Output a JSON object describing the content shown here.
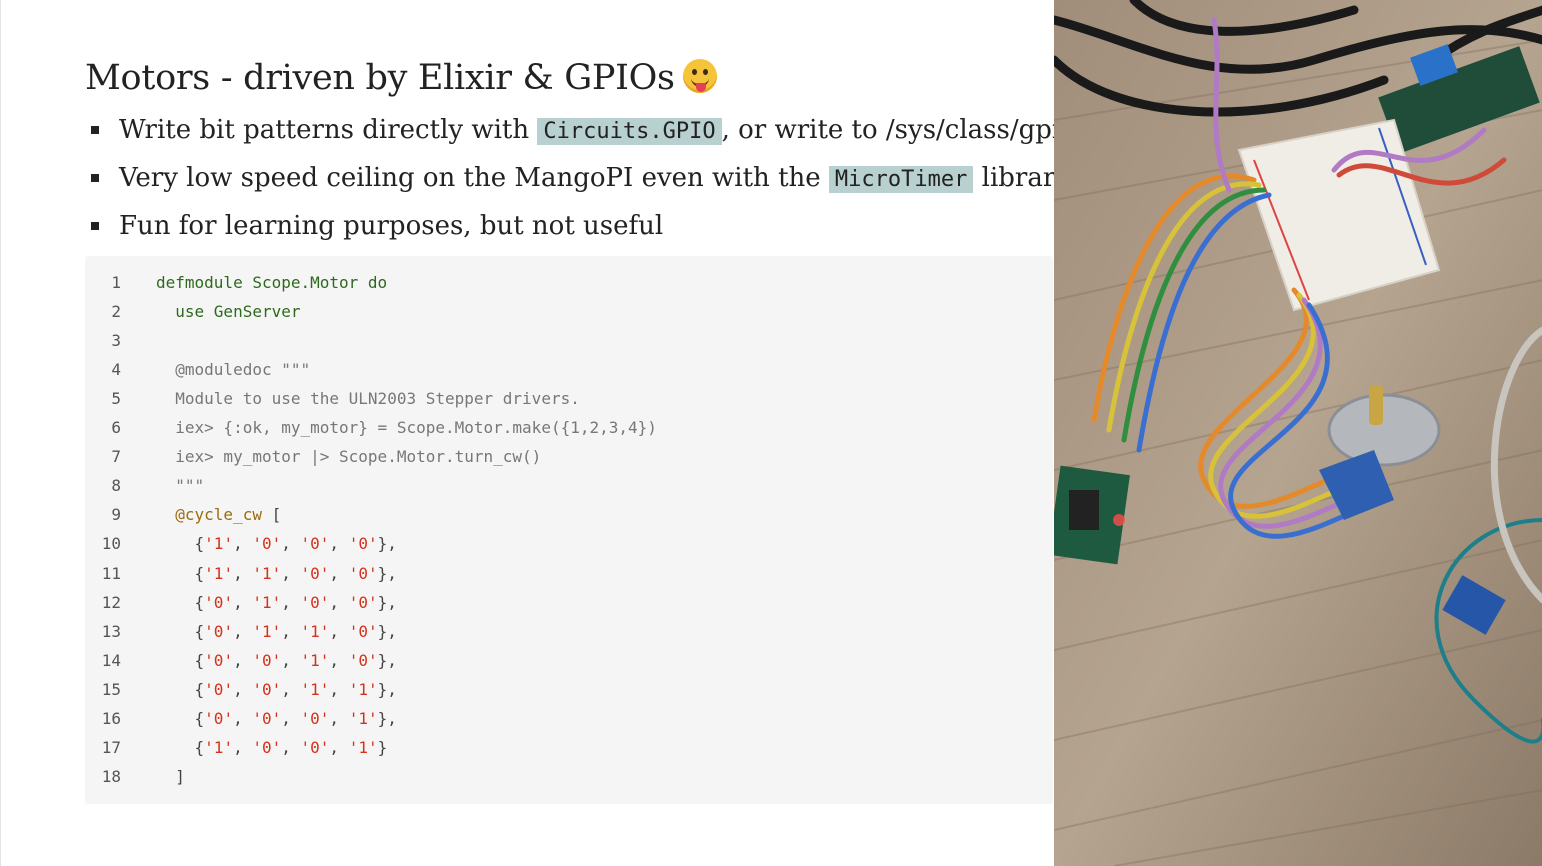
{
  "slide": {
    "title": "Motors - driven by Elixir & GPIOs",
    "title_emoji": "face-with-tongue-emoji",
    "bullets": [
      {
        "pre": "Write bit patterns directly with ",
        "code": "Circuits.GPIO",
        "post": ", or write to /sys/class/gpio/"
      },
      {
        "pre": "Very low speed ceiling on the MangoPI even with the ",
        "code": "MicroTimer",
        "post": " library"
      },
      {
        "pre": "Fun for learning purposes, but not useful",
        "code": "",
        "post": ""
      }
    ],
    "code_lines": [
      {
        "num": "1",
        "parts": [
          [
            "k",
            "defmodule Scope.Motor do"
          ]
        ]
      },
      {
        "num": "2",
        "parts": [
          [
            "p",
            "  "
          ],
          [
            "k",
            "use GenServer"
          ]
        ]
      },
      {
        "num": "3",
        "parts": []
      },
      {
        "num": "4",
        "parts": [
          [
            "c",
            "  @moduledoc \"\"\""
          ]
        ]
      },
      {
        "num": "5",
        "parts": [
          [
            "c",
            "  Module to use the ULN2003 Stepper drivers."
          ]
        ]
      },
      {
        "num": "6",
        "parts": [
          [
            "c",
            "  iex> {:ok, my_motor} = Scope.Motor.make({1,2,3,4})"
          ]
        ]
      },
      {
        "num": "7",
        "parts": [
          [
            "c",
            "  iex> my_motor |> Scope.Motor.turn_cw()"
          ]
        ]
      },
      {
        "num": "8",
        "parts": [
          [
            "c",
            "  \"\"\""
          ]
        ]
      },
      {
        "num": "9",
        "parts": [
          [
            "p",
            "  "
          ],
          [
            "a",
            "@cycle_cw"
          ],
          [
            "p",
            " ["
          ]
        ]
      },
      {
        "num": "10",
        "parts": [
          [
            "p",
            "    {"
          ],
          [
            "s",
            "'1'"
          ],
          [
            "p",
            ", "
          ],
          [
            "s",
            "'0'"
          ],
          [
            "p",
            ", "
          ],
          [
            "s",
            "'0'"
          ],
          [
            "p",
            ", "
          ],
          [
            "s",
            "'0'"
          ],
          [
            "p",
            "},"
          ]
        ]
      },
      {
        "num": "11",
        "parts": [
          [
            "p",
            "    {"
          ],
          [
            "s",
            "'1'"
          ],
          [
            "p",
            ", "
          ],
          [
            "s",
            "'1'"
          ],
          [
            "p",
            ", "
          ],
          [
            "s",
            "'0'"
          ],
          [
            "p",
            ", "
          ],
          [
            "s",
            "'0'"
          ],
          [
            "p",
            "},"
          ]
        ]
      },
      {
        "num": "12",
        "parts": [
          [
            "p",
            "    {"
          ],
          [
            "s",
            "'0'"
          ],
          [
            "p",
            ", "
          ],
          [
            "s",
            "'1'"
          ],
          [
            "p",
            ", "
          ],
          [
            "s",
            "'0'"
          ],
          [
            "p",
            ", "
          ],
          [
            "s",
            "'0'"
          ],
          [
            "p",
            "},"
          ]
        ]
      },
      {
        "num": "13",
        "parts": [
          [
            "p",
            "    {"
          ],
          [
            "s",
            "'0'"
          ],
          [
            "p",
            ", "
          ],
          [
            "s",
            "'1'"
          ],
          [
            "p",
            ", "
          ],
          [
            "s",
            "'1'"
          ],
          [
            "p",
            ", "
          ],
          [
            "s",
            "'0'"
          ],
          [
            "p",
            "},"
          ]
        ]
      },
      {
        "num": "14",
        "parts": [
          [
            "p",
            "    {"
          ],
          [
            "s",
            "'0'"
          ],
          [
            "p",
            ", "
          ],
          [
            "s",
            "'0'"
          ],
          [
            "p",
            ", "
          ],
          [
            "s",
            "'1'"
          ],
          [
            "p",
            ", "
          ],
          [
            "s",
            "'0'"
          ],
          [
            "p",
            "},"
          ]
        ]
      },
      {
        "num": "15",
        "parts": [
          [
            "p",
            "    {"
          ],
          [
            "s",
            "'0'"
          ],
          [
            "p",
            ", "
          ],
          [
            "s",
            "'0'"
          ],
          [
            "p",
            ", "
          ],
          [
            "s",
            "'1'"
          ],
          [
            "p",
            ", "
          ],
          [
            "s",
            "'1'"
          ],
          [
            "p",
            "},"
          ]
        ]
      },
      {
        "num": "16",
        "parts": [
          [
            "p",
            "    {"
          ],
          [
            "s",
            "'0'"
          ],
          [
            "p",
            ", "
          ],
          [
            "s",
            "'0'"
          ],
          [
            "p",
            ", "
          ],
          [
            "s",
            "'0'"
          ],
          [
            "p",
            ", "
          ],
          [
            "s",
            "'1'"
          ],
          [
            "p",
            "},"
          ]
        ]
      },
      {
        "num": "17",
        "parts": [
          [
            "p",
            "    {"
          ],
          [
            "s",
            "'1'"
          ],
          [
            "p",
            ", "
          ],
          [
            "s",
            "'0'"
          ],
          [
            "p",
            ", "
          ],
          [
            "s",
            "'0'"
          ],
          [
            "p",
            ", "
          ],
          [
            "s",
            "'1'"
          ],
          [
            "p",
            "}"
          ]
        ]
      },
      {
        "num": "18",
        "parts": [
          [
            "p",
            "  ]"
          ]
        ]
      }
    ],
    "photo_icon": "stepper-motor-breadboard-photo"
  },
  "colors": {
    "inline_code_bg": "#b8d0d0",
    "keyword": "#2d6a1d",
    "comment": "#777777",
    "string": "#d4321c",
    "attribute": "#9a6c12",
    "code_bg": "#f5f5f5"
  }
}
